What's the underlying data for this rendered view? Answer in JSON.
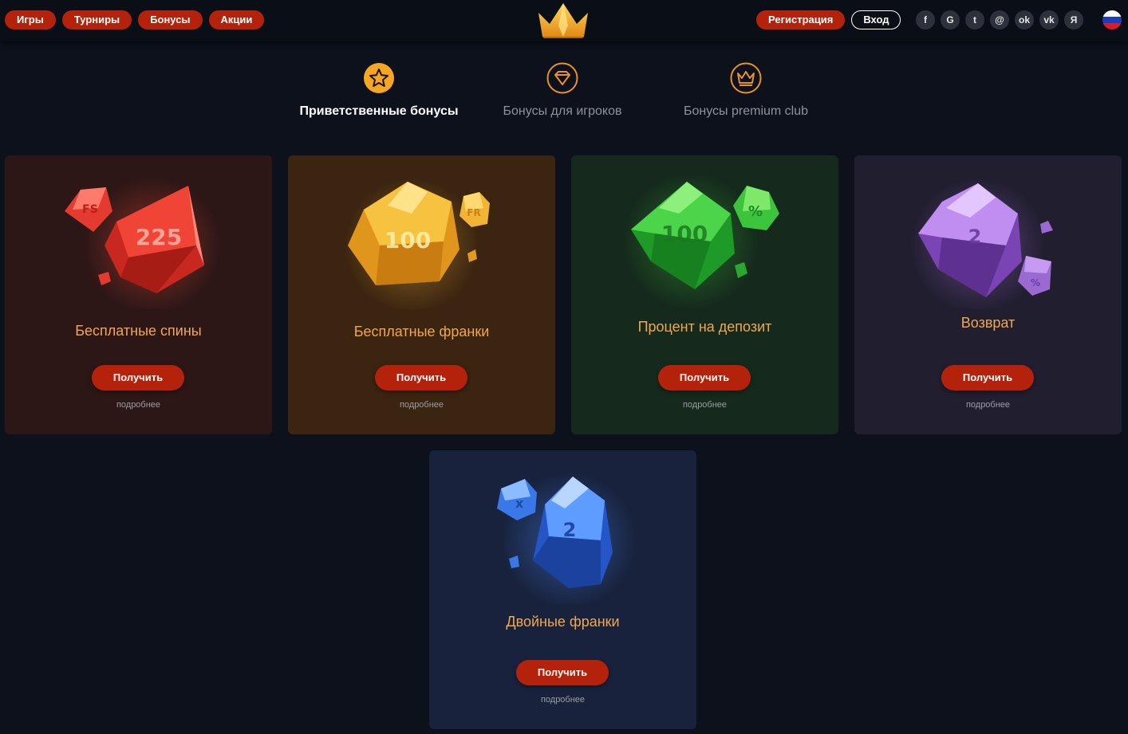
{
  "header": {
    "nav": [
      "Игры",
      "Турниры",
      "Бонусы",
      "Акции"
    ],
    "register_label": "Регистрация",
    "login_label": "Вход",
    "socials": [
      {
        "icon": "facebook-icon",
        "glyph": "f"
      },
      {
        "icon": "google-icon",
        "glyph": "G"
      },
      {
        "icon": "twitter-icon",
        "glyph": "t"
      },
      {
        "icon": "mail-icon",
        "glyph": "@"
      },
      {
        "icon": "odnoklassniki-icon",
        "glyph": "ok"
      },
      {
        "icon": "vk-icon",
        "glyph": "vk"
      },
      {
        "icon": "yandex-icon",
        "glyph": "Я"
      }
    ],
    "language_flag": "ru-flag-icon"
  },
  "tabs": [
    {
      "label": "Приветственные бонусы",
      "icon": "star-icon",
      "active": true
    },
    {
      "label": "Бонусы для игроков",
      "icon": "diamond-icon",
      "active": false
    },
    {
      "label": "Бонусы premium club",
      "icon": "crown-icon",
      "active": false
    }
  ],
  "cards": [
    {
      "title": "Бесплатные спины",
      "gem_main": "225",
      "gem_small": "FS",
      "button": "Получить",
      "more": "подробнее",
      "bg": "#2d1716",
      "gem_color": "#e53a30"
    },
    {
      "title": "Бесплатные франки",
      "gem_main": "100",
      "gem_small": "FR",
      "button": "Получить",
      "more": "подробнее",
      "bg": "#3b2410",
      "gem_color": "#f2b434"
    },
    {
      "title": "Процент на депозит",
      "gem_main": "100",
      "gem_small": "%",
      "button": "Получить",
      "more": "подробнее",
      "bg": "#152a1c",
      "gem_color": "#3cc43c"
    },
    {
      "title": "Возврат",
      "gem_main": "2",
      "gem_small": "%",
      "button": "Получить",
      "more": "подробнее",
      "bg": "#211e30",
      "gem_color": "#a46ad8"
    },
    {
      "title": "Двойные франки",
      "gem_main": "2",
      "gem_small": "x",
      "button": "Получить",
      "more": "подробнее",
      "bg": "#18223d",
      "gem_color": "#3a78e8"
    }
  ],
  "colors": {
    "accent": "#b4220c",
    "title": "#f0a750",
    "page_bg": "#0c111b"
  }
}
